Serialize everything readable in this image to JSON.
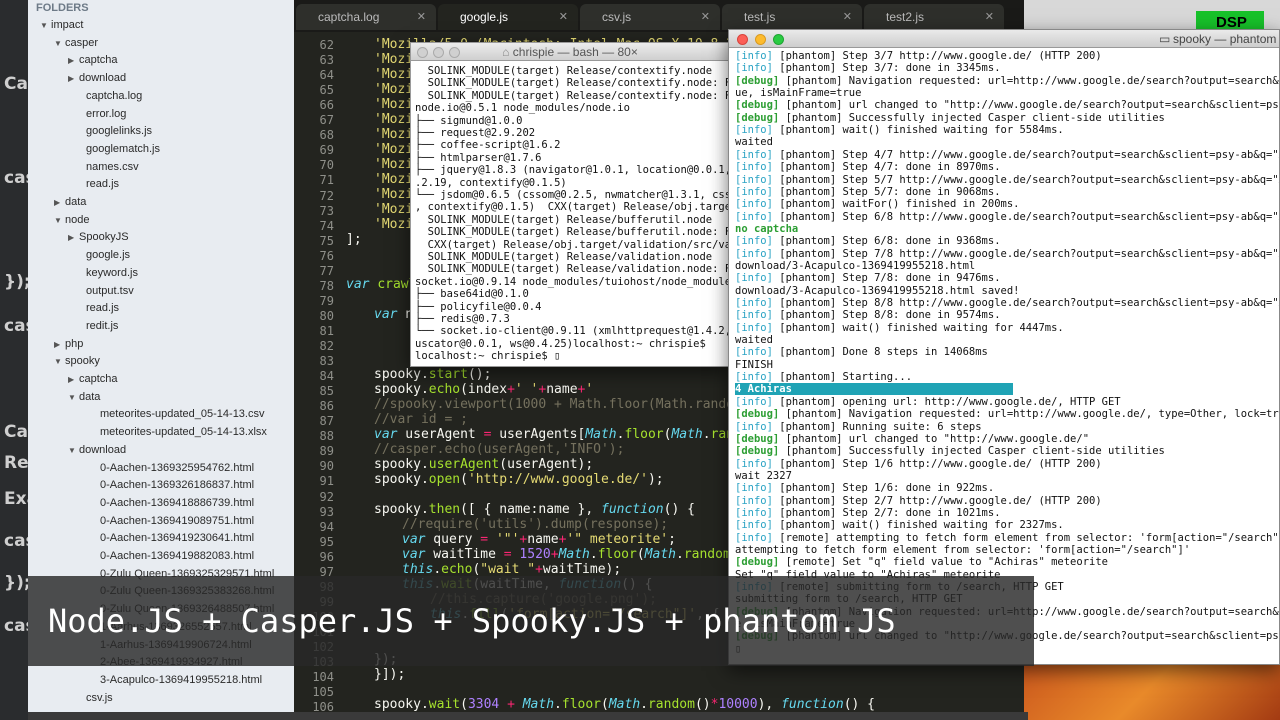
{
  "left_strip": {
    "fragments": [
      "Cas",
      "cas",
      "});",
      "cas",
      "Cas",
      "Repo",
      "Exam",
      "cas",
      "});",
      "cas"
    ]
  },
  "sidebar": {
    "header": "FOLDERS",
    "rows": [
      {
        "label": "impact",
        "type": "folder-open",
        "indent": 0
      },
      {
        "label": "casper",
        "type": "folder-open",
        "indent": 1
      },
      {
        "label": "captcha",
        "type": "folder-closed",
        "indent": 2
      },
      {
        "label": "download",
        "type": "folder-closed",
        "indent": 2
      },
      {
        "label": "captcha.log",
        "type": "file",
        "indent": 2
      },
      {
        "label": "error.log",
        "type": "file",
        "indent": 2
      },
      {
        "label": "googlelinks.js",
        "type": "file",
        "indent": 2
      },
      {
        "label": "googlematch.js",
        "type": "file",
        "indent": 2
      },
      {
        "label": "names.csv",
        "type": "file",
        "indent": 2
      },
      {
        "label": "read.js",
        "type": "file",
        "indent": 2
      },
      {
        "label": "data",
        "type": "folder-closed",
        "indent": 1
      },
      {
        "label": "node",
        "type": "folder-open",
        "indent": 1
      },
      {
        "label": "SpookyJS",
        "type": "folder-closed",
        "indent": 2
      },
      {
        "label": "google.js",
        "type": "file",
        "indent": 2
      },
      {
        "label": "keyword.js",
        "type": "file",
        "indent": 2
      },
      {
        "label": "output.tsv",
        "type": "file",
        "indent": 2
      },
      {
        "label": "read.js",
        "type": "file",
        "indent": 2
      },
      {
        "label": "redit.js",
        "type": "file",
        "indent": 2
      },
      {
        "label": "php",
        "type": "folder-closed",
        "indent": 1
      },
      {
        "label": "spooky",
        "type": "folder-open",
        "indent": 1
      },
      {
        "label": "captcha",
        "type": "folder-closed",
        "indent": 2
      },
      {
        "label": "data",
        "type": "folder-open",
        "indent": 2
      },
      {
        "label": "meteorites-updated_05-14-13.csv",
        "type": "file",
        "indent": 3
      },
      {
        "label": "meteorites-updated_05-14-13.xlsx",
        "type": "file",
        "indent": 3
      },
      {
        "label": "download",
        "type": "folder-open",
        "indent": 2
      },
      {
        "label": "0-Aachen-1369325954762.html",
        "type": "file",
        "indent": 3
      },
      {
        "label": "0-Aachen-1369326186837.html",
        "type": "file",
        "indent": 3
      },
      {
        "label": "0-Aachen-1369418886739.html",
        "type": "file",
        "indent": 3
      },
      {
        "label": "0-Aachen-1369419089751.html",
        "type": "file",
        "indent": 3
      },
      {
        "label": "0-Aachen-1369419230641.html",
        "type": "file",
        "indent": 3
      },
      {
        "label": "0-Aachen-1369419882083.html",
        "type": "file",
        "indent": 3
      },
      {
        "label": "0-Zulu Queen-1369325329571.html",
        "type": "file",
        "indent": 3
      },
      {
        "label": "0-Zulu Queen-1369325383268.html",
        "type": "file",
        "indent": 3
      },
      {
        "label": "0-Zulu Queen-1369326488507.html",
        "type": "file",
        "indent": 3
      },
      {
        "label": "1-Aarhus-1369326552557.html",
        "type": "file",
        "indent": 3
      },
      {
        "label": "1-Aarhus-1369419906724.html",
        "type": "file",
        "indent": 3
      },
      {
        "label": "2-Abee-1369419934927.html",
        "type": "file",
        "indent": 3
      },
      {
        "label": "3-Acapulco-1369419955218.html",
        "type": "file",
        "indent": 3
      },
      {
        "label": "csv.js",
        "type": "file",
        "indent": 2
      }
    ]
  },
  "tabs": [
    {
      "label": "captcha.log",
      "active": false
    },
    {
      "label": "google.js",
      "active": true
    },
    {
      "label": "csv.js",
      "active": false
    },
    {
      "label": "test.js",
      "active": false
    },
    {
      "label": "test2.js",
      "active": false
    }
  ],
  "tab_close": "✕",
  "line_numbers": [
    "62",
    "63",
    "64",
    "65",
    "66",
    "67",
    "68",
    "69",
    "70",
    "71",
    "72",
    "73",
    "74",
    "75",
    "76",
    "77",
    "78",
    "79",
    "80",
    "81",
    "82",
    "83",
    "84",
    "85",
    "86",
    "87",
    "88",
    "89",
    "90",
    "91",
    "92",
    "93",
    "94",
    "95",
    "96",
    "97",
    "98",
    "99",
    "100",
    "101",
    "102",
    "103",
    "104",
    "105",
    "106"
  ],
  "bash": {
    "title": "chrispie — bash — 80×",
    "lines": [
      "  SOLINK_MODULE(target) Release/contextify.node",
      "  SOLINK_MODULE(target) Release/contextify.node: Fi",
      "  SOLINK_MODULE(target) Release/contextify.node: Fi",
      "node.io@0.5.1 node_modules/node.io",
      "├── sigmund@1.0.0",
      "├── request@2.9.202",
      "├── coffee-script@1.6.2",
      "├── htmlparser@1.7.6",
      "├── jquery@1.8.3 (navigator@1.0.1, location@0.0.1,",
      ".2.19, contextify@0.1.5)",
      "└── jsdom@0.6.5 (cssom@0.2.5, nwmatcher@1.3.1, csss",
      ", contextify@0.1.5)  CXX(target) Release/obj.target",
      "  SOLINK_MODULE(target) Release/bufferutil.node",
      "  SOLINK_MODULE(target) Release/bufferutil.node: Fi",
      "  CXX(target) Release/obj.target/validation/src/val",
      "  SOLINK_MODULE(target) Release/validation.node",
      "  SOLINK_MODULE(target) Release/validation.node: Fi",
      "socket.io@0.9.14 node_modules/tuiohost/node_modules",
      "├── base64id@0.1.0",
      "├── policyfile@0.0.4",
      "├── redis@0.7.3",
      "└── socket.io-client@0.9.11 (xmlhttprequest@1.4.2,",
      "uscator@0.0.1, ws@0.4.25)localhost:~ chrispie$",
      "localhost:~ chrispie$ ▯"
    ]
  },
  "spooky": {
    "title": "spooky — phantom",
    "lines": [
      {
        "tag": "[info]",
        "cls": "tinfo",
        "text": " [phantom] Step 3/7 http://www.google.de/ (HTTP 200)"
      },
      {
        "tag": "[info]",
        "cls": "tinfo",
        "text": " [phantom] Step 3/7: done in 3345ms."
      },
      {
        "tag": "[debug]",
        "cls": "tdebug",
        "text": " [phantom] Navigation requested: url=http://www.google.de/search?output=search&sc"
      },
      {
        "tag": "",
        "cls": "",
        "text": "ue, isMainFrame=true"
      },
      {
        "tag": "[debug]",
        "cls": "tdebug",
        "text": " [phantom] url changed to \"http://www.google.de/search?output=search&sclient=psy-"
      },
      {
        "tag": "[debug]",
        "cls": "tdebug",
        "text": " [phantom] Successfully injected Casper client-side utilities"
      },
      {
        "tag": "[info]",
        "cls": "tinfo",
        "text": " [phantom] wait() finished waiting for 5584ms."
      },
      {
        "tag": "",
        "cls": "",
        "text": "waited"
      },
      {
        "tag": "[info]",
        "cls": "tinfo",
        "text": " [phantom] Step 4/7 http://www.google.de/search?output=search&sclient=psy-ab&q=\"Ac"
      },
      {
        "tag": "[info]",
        "cls": "tinfo",
        "text": " [phantom] Step 4/7: done in 8970ms."
      },
      {
        "tag": "[info]",
        "cls": "tinfo",
        "text": " [phantom] Step 5/7 http://www.google.de/search?output=search&sclient=psy-ab&q=\"Ac"
      },
      {
        "tag": "[info]",
        "cls": "tinfo",
        "text": " [phantom] Step 5/7: done in 9068ms."
      },
      {
        "tag": "[info]",
        "cls": "tinfo",
        "text": " [phantom] waitFor() finished in 200ms."
      },
      {
        "tag": "[info]",
        "cls": "tinfo",
        "text": " [phantom] Step 6/8 http://www.google.de/search?output=search&sclient=psy-ab&q=\"Ac"
      },
      {
        "tag": "no captcha",
        "cls": "tgreen",
        "text": ""
      },
      {
        "tag": "[info]",
        "cls": "tinfo",
        "text": " [phantom] Step 6/8: done in 9368ms."
      },
      {
        "tag": "[info]",
        "cls": "tinfo",
        "text": " [phantom] Step 7/8 http://www.google.de/search?output=search&sclient=psy-ab&q=\"Ac"
      },
      {
        "tag": "",
        "cls": "",
        "text": "download/3-Acapulco-1369419955218.html"
      },
      {
        "tag": "[info]",
        "cls": "tinfo",
        "text": " [phantom] Step 7/8: done in 9476ms."
      },
      {
        "tag": "",
        "cls": "",
        "text": "download/3-Acapulco-1369419955218.html saved!"
      },
      {
        "tag": "[info]",
        "cls": "tinfo",
        "text": " [phantom] Step 8/8 http://www.google.de/search?output=search&sclient=psy-ab&q=\"Ac"
      },
      {
        "tag": "[info]",
        "cls": "tinfo",
        "text": " [phantom] Step 8/8: done in 9574ms."
      },
      {
        "tag": "[info]",
        "cls": "tinfo",
        "text": " [phantom] wait() finished waiting for 4447ms."
      },
      {
        "tag": "",
        "cls": "",
        "text": "waited"
      },
      {
        "tag": "[info]",
        "cls": "tinfo",
        "text": " [phantom] Done 8 steps in 14068ms"
      },
      {
        "tag": "",
        "cls": "",
        "text": "FINISH"
      },
      {
        "tag": "[info]",
        "cls": "tinfo",
        "text": " [phantom] Starting..."
      },
      {
        "tag": "4 Achiras",
        "cls": "hl",
        "text": "                                   "
      },
      {
        "tag": "[info]",
        "cls": "tinfo",
        "text": " [phantom] opening url: http://www.google.de/, HTTP GET"
      },
      {
        "tag": "[debug]",
        "cls": "tdebug",
        "text": " [phantom] Navigation requested: url=http://www.google.de/, type=Other, lock=true"
      },
      {
        "tag": "[info]",
        "cls": "tinfo",
        "text": " [phantom] Running suite: 6 steps"
      },
      {
        "tag": "[debug]",
        "cls": "tdebug",
        "text": " [phantom] url changed to \"http://www.google.de/\""
      },
      {
        "tag": "[debug]",
        "cls": "tdebug",
        "text": " [phantom] Successfully injected Casper client-side utilities"
      },
      {
        "tag": "[info]",
        "cls": "tinfo",
        "text": " [phantom] Step 1/6 http://www.google.de/ (HTTP 200)"
      },
      {
        "tag": "",
        "cls": "",
        "text": "wait 2327"
      },
      {
        "tag": "[info]",
        "cls": "tinfo",
        "text": " [phantom] Step 1/6: done in 922ms."
      },
      {
        "tag": "[info]",
        "cls": "tinfo",
        "text": " [phantom] Step 2/7 http://www.google.de/ (HTTP 200)"
      },
      {
        "tag": "[info]",
        "cls": "tinfo",
        "text": " [phantom] Step 2/7: done in 1021ms."
      },
      {
        "tag": "[info]",
        "cls": "tinfo",
        "text": " [phantom] wait() finished waiting for 2327ms."
      },
      {
        "tag": "[info]",
        "cls": "tinfo",
        "text": " [remote] attempting to fetch form element from selector: 'form[action=\"/search\"]'"
      },
      {
        "tag": "",
        "cls": "",
        "text": "attempting to fetch form element from selector: 'form[action=\"/search\"]'"
      },
      {
        "tag": "[debug]",
        "cls": "tdebug",
        "text": " [remote] Set \"q\" field value to \"Achiras\" meteorite"
      },
      {
        "tag": "",
        "cls": "",
        "text": "Set \"q\" field value to \"Achiras\" meteorite"
      },
      {
        "tag": "[info]",
        "cls": "tinfo",
        "text": " [remote] submitting form to /search, HTTP GET"
      },
      {
        "tag": "",
        "cls": "",
        "text": "submitting form to /search, HTTP GET"
      },
      {
        "tag": "[debug]",
        "cls": "tdebug",
        "text": " [phantom] Navigation requested: url=http://www.google.de/search?output=search&sc"
      },
      {
        "tag": "",
        "cls": "",
        "text": "e, isMainFrame=true"
      },
      {
        "tag": "[debug]",
        "cls": "tdebug",
        "text": " [phantom] url changed to \"http://www.google.de/search?output=search&sclient=psy-"
      },
      {
        "tag": "",
        "cls": "",
        "text": "▯"
      }
    ]
  },
  "dsp_label": "DSP",
  "caption": "Node.JS + Casper.JS + Spooky.JS + phantom.JS"
}
